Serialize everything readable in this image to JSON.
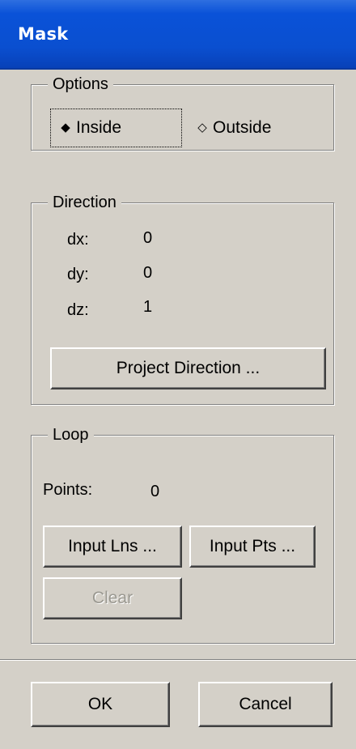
{
  "window": {
    "title": "Mask"
  },
  "options": {
    "label": "Options",
    "inside_label": "Inside",
    "outside_label": "Outside",
    "selected": "Inside"
  },
  "direction": {
    "label": "Direction",
    "dx_label": "dx:",
    "dx_value": "0",
    "dy_label": "dy:",
    "dy_value": "0",
    "dz_label": "dz:",
    "dz_value": "1",
    "project_button": "Project Direction ..."
  },
  "loop": {
    "label": "Loop",
    "points_label": "Points:",
    "points_value": "0",
    "input_lns_button": "Input Lns ...",
    "input_pts_button": "Input Pts ...",
    "clear_button": "Clear"
  },
  "footer": {
    "ok_button": "OK",
    "cancel_button": "Cancel"
  },
  "icons": {
    "radio_selected": "filled-diamond-icon",
    "radio_unselected": "hollow-diamond-icon"
  },
  "colors": {
    "titlebar": "#0a52d8",
    "background": "#d4d0c8",
    "disabled_text": "#9a9890"
  }
}
